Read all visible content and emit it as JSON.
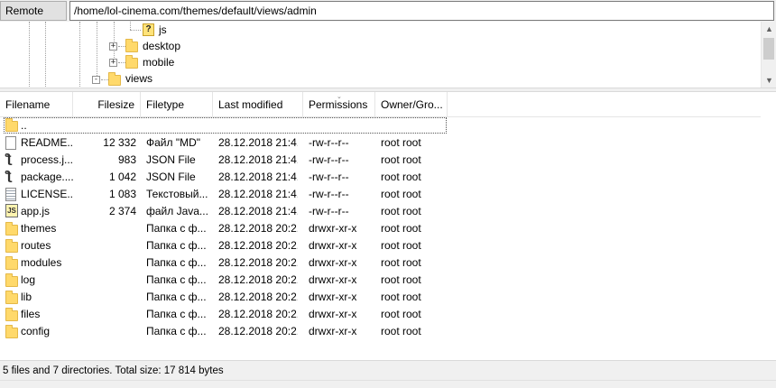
{
  "remote": {
    "label": "Remote site:",
    "path": "/home/lol-cinema.com/themes/default/views/admin"
  },
  "tree": {
    "items": [
      {
        "label": "js",
        "icon": "question-file-icon"
      },
      {
        "label": "desktop",
        "icon": "folder-icon",
        "expander": "+"
      },
      {
        "label": "mobile",
        "icon": "folder-icon",
        "expander": "+"
      },
      {
        "label": "views",
        "icon": "folder-icon",
        "expander": "-"
      }
    ],
    "scroll": {
      "up": "▲",
      "down": "▼"
    }
  },
  "list": {
    "columns": [
      "Filename",
      "Filesize",
      "Filetype",
      "Last modified",
      "Permissions",
      "Owner/Gro..."
    ],
    "sort_indicator": "⌄",
    "parent_entry": "..",
    "rows": [
      {
        "name": "README...",
        "size": "12 332",
        "type": "Файл \"MD\"",
        "modified": "28.12.2018 21:4...",
        "perms": "-rw-r--r--",
        "owner": "root root",
        "icon": "document-icon"
      },
      {
        "name": "process.j...",
        "size": "983",
        "type": "JSON File",
        "modified": "28.12.2018 21:4...",
        "perms": "-rw-r--r--",
        "owner": "root root",
        "icon": "json-file-icon"
      },
      {
        "name": "package....",
        "size": "1 042",
        "type": "JSON File",
        "modified": "28.12.2018 21:4...",
        "perms": "-rw-r--r--",
        "owner": "root root",
        "icon": "json-file-icon"
      },
      {
        "name": "LICENSE....",
        "size": "1 083",
        "type": "Текстовый...",
        "modified": "28.12.2018 21:4...",
        "perms": "-rw-r--r--",
        "owner": "root root",
        "icon": "text-file-icon"
      },
      {
        "name": "app.js",
        "size": "2 374",
        "type": "файл Java...",
        "modified": "28.12.2018 21:4...",
        "perms": "-rw-r--r--",
        "owner": "root root",
        "icon": "js-file-icon"
      },
      {
        "name": "themes",
        "size": "",
        "type": "Папка с ф...",
        "modified": "28.12.2018 20:2...",
        "perms": "drwxr-xr-x",
        "owner": "root root",
        "icon": "folder-icon"
      },
      {
        "name": "routes",
        "size": "",
        "type": "Папка с ф...",
        "modified": "28.12.2018 20:2...",
        "perms": "drwxr-xr-x",
        "owner": "root root",
        "icon": "folder-icon"
      },
      {
        "name": "modules",
        "size": "",
        "type": "Папка с ф...",
        "modified": "28.12.2018 20:2...",
        "perms": "drwxr-xr-x",
        "owner": "root root",
        "icon": "folder-icon"
      },
      {
        "name": "log",
        "size": "",
        "type": "Папка с ф...",
        "modified": "28.12.2018 20:2...",
        "perms": "drwxr-xr-x",
        "owner": "root root",
        "icon": "folder-icon"
      },
      {
        "name": "lib",
        "size": "",
        "type": "Папка с ф...",
        "modified": "28.12.2018 20:2...",
        "perms": "drwxr-xr-x",
        "owner": "root root",
        "icon": "folder-icon"
      },
      {
        "name": "files",
        "size": "",
        "type": "Папка с ф...",
        "modified": "28.12.2018 20:2...",
        "perms": "drwxr-xr-x",
        "owner": "root root",
        "icon": "folder-icon"
      },
      {
        "name": "config",
        "size": "",
        "type": "Папка с ф...",
        "modified": "28.12.2018 20:2...",
        "perms": "drwxr-xr-x",
        "owner": "root root",
        "icon": "folder-icon"
      }
    ]
  },
  "status": {
    "text": "5 files and 7 directories. Total size: 17 814 bytes"
  },
  "colors": {
    "folder": "#ffd96b",
    "background": "#f0f0f0",
    "list_background": "#ffffff"
  }
}
